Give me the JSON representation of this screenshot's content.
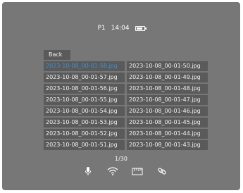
{
  "status": {
    "mode": "P1",
    "time": "14:04",
    "battery_icon": "battery-icon"
  },
  "back_label": "Back",
  "files": {
    "left": [
      "2023-10-08_00-01-58.jpg",
      "2023-10-08_00-01-57.jpg",
      "2023-10-08_00-01-56.jpg",
      "2023-10-08_00-01-55.jpg",
      "2023-10-08_00-01-54.jpg",
      "2023-10-08_00-01-53.jpg",
      "2023-10-08_00-01-52.jpg",
      "2023-10-08_00-01-51.jpg"
    ],
    "right": [
      "2023-10-08_00-01-50.jpg",
      "2023-10-08_00-01-49.jpg",
      "2023-10-08_00-01-48.jpg",
      "2023-10-08_00-01-47.jpg",
      "2023-10-08_00-01-46.jpg",
      "2023-10-08_00-01-45.jpg",
      "2023-10-08_00-01-44.jpg",
      "2023-10-08_00-01-43.jpg"
    ],
    "selected": "2023-10-08_00-01-58.jpg"
  },
  "pagination": "1/30",
  "bottom_icons": [
    "microphone-icon",
    "wifi-icon",
    "ruler-icon",
    "link-icon"
  ],
  "colors": {
    "screen_bg": "#777777",
    "cell_bg": "#5a5a5a",
    "selected_text": "#3f8fd6"
  }
}
